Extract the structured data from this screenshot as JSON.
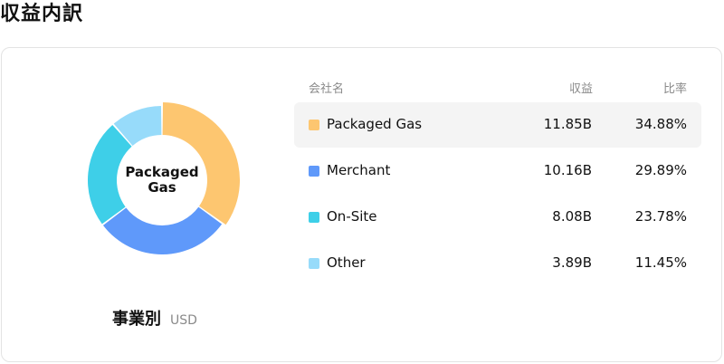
{
  "page": {
    "title": "収益内訳"
  },
  "donut": {
    "center_label": "Packaged Gas"
  },
  "caption": {
    "main": "事業別",
    "unit": "USD"
  },
  "table": {
    "headers": {
      "name": "会社名",
      "revenue": "収益",
      "ratio": "比率"
    },
    "rows": [
      {
        "name": "Packaged Gas",
        "revenue": "11.85B",
        "ratio": "34.88%",
        "color": "#FDC670",
        "selected": true
      },
      {
        "name": "Merchant",
        "revenue": "10.16B",
        "ratio": "29.89%",
        "color": "#5F99FA",
        "selected": false
      },
      {
        "name": "On-Site",
        "revenue": "8.08B",
        "ratio": "23.78%",
        "color": "#3ECFE8",
        "selected": false
      },
      {
        "name": "Other",
        "revenue": "3.89B",
        "ratio": "11.45%",
        "color": "#97DBFA",
        "selected": false
      }
    ]
  },
  "chart_data": {
    "type": "pie",
    "categories": [
      "Packaged Gas",
      "Merchant",
      "On-Site",
      "Other"
    ],
    "values": [
      34.88,
      29.89,
      23.78,
      11.45
    ],
    "colors": [
      "#FDC670",
      "#5F99FA",
      "#3ECFE8",
      "#97DBFA"
    ],
    "selected": "Packaged Gas"
  }
}
